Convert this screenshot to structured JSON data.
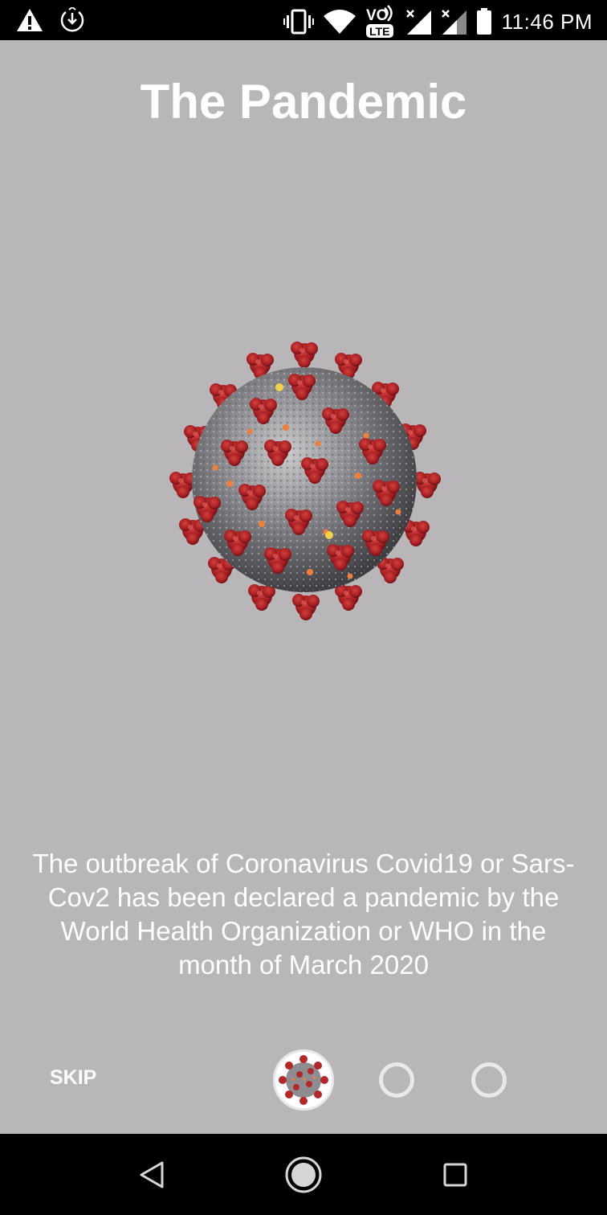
{
  "status_bar": {
    "time": "11:46 PM",
    "left_icons": [
      "warning-icon",
      "download-icon"
    ],
    "right_icons": [
      "vibrate-icon",
      "wifi-icon",
      "volte-icon",
      "signal-icon",
      "signal-icon",
      "battery-icon"
    ],
    "network_label_top": "VO",
    "network_label_bottom": "LTE"
  },
  "onboarding": {
    "title": "The Pandemic",
    "description": "The outbreak of Coronavirus Covid19 or Sars-Cov2 has been declared a pandemic by the World Health Organization or WHO in the month of March 2020",
    "image": "coronavirus-illustration",
    "skip_label": "SKIP",
    "page_count": 3,
    "current_page": 1
  },
  "nav_bar": {
    "icons": [
      "back-icon",
      "home-icon",
      "recents-icon"
    ]
  },
  "colors": {
    "background": "#b8b6b9",
    "text": "#ffffff",
    "virus_body": "#8f8f93",
    "virus_spike": "#b2272a",
    "virus_accent": "#f07e3c",
    "bar": "#000000"
  }
}
